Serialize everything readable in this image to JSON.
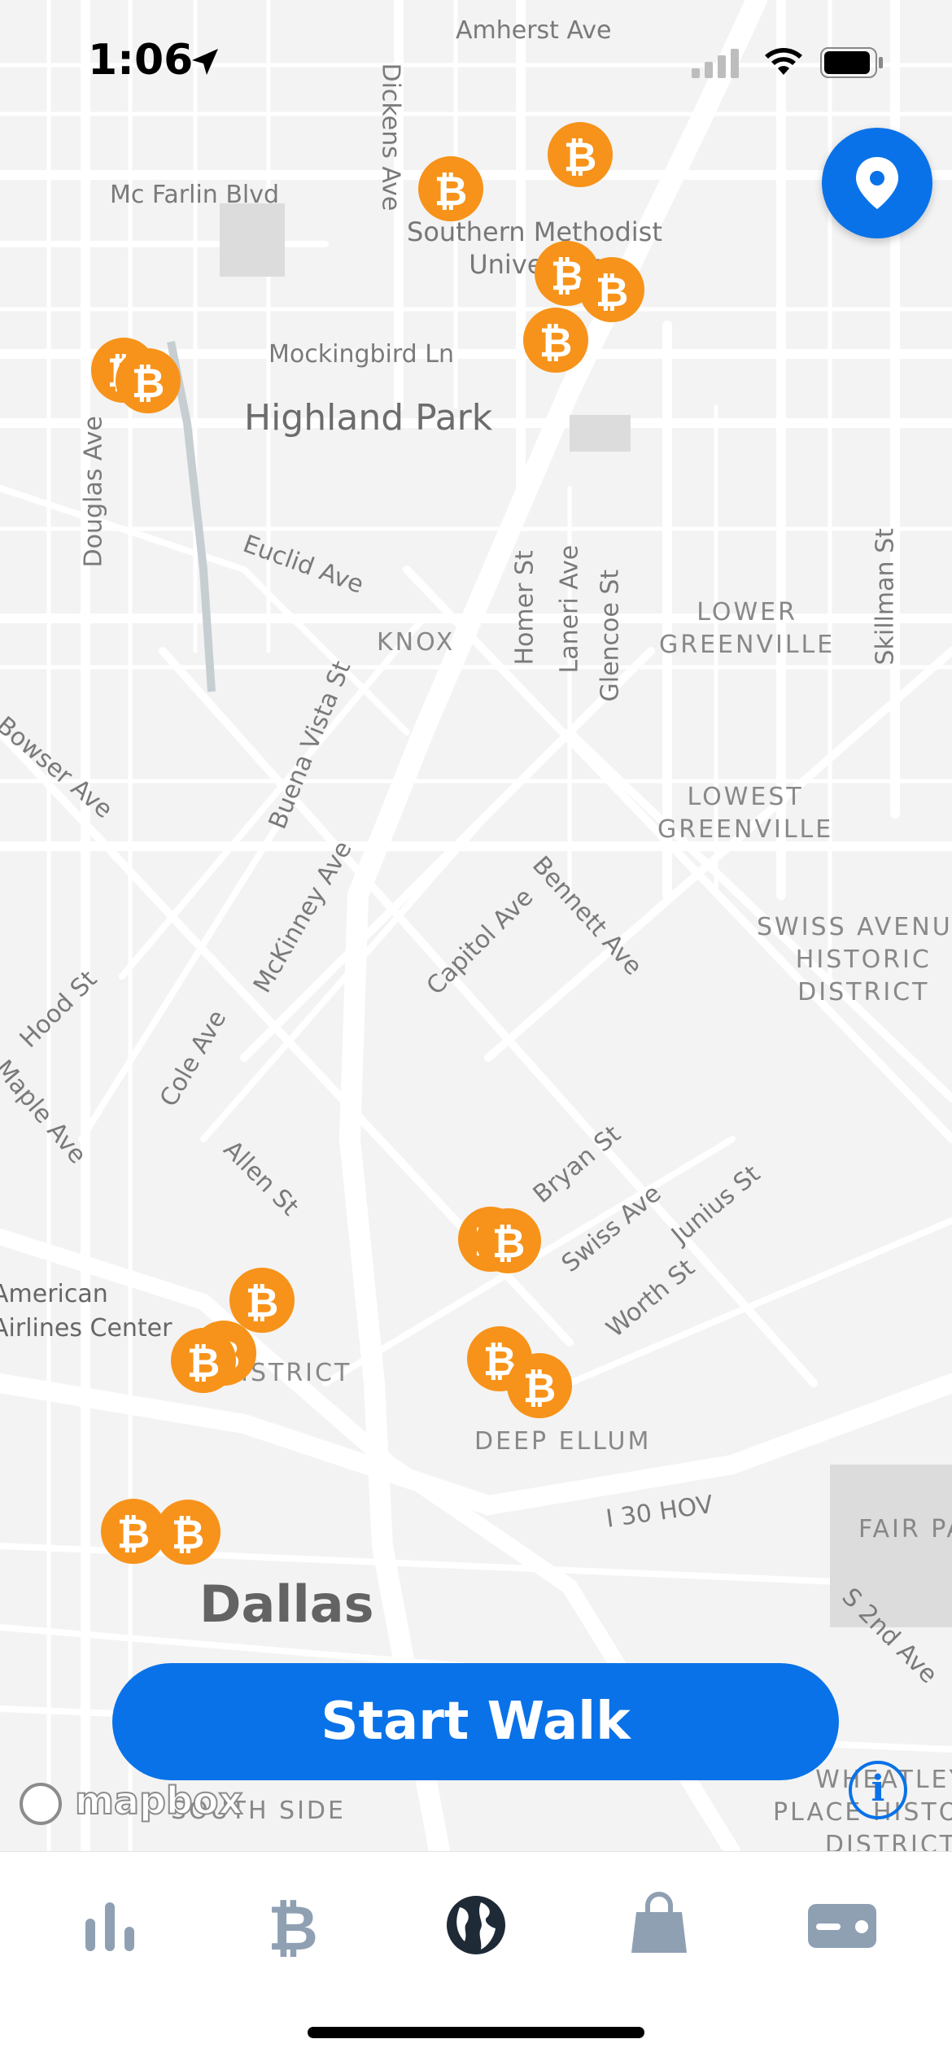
{
  "status_bar": {
    "time": "1:06"
  },
  "map": {
    "streets": [
      "Amherst Ave",
      "Mc Farlin Blvd",
      "Dickens Ave",
      "Mockingbird Ln",
      "Douglas Ave",
      "Euclid Ave",
      "Homer St",
      "Laneri Ave",
      "Glencoe St",
      "Skillman St",
      "Bowser Ave",
      "Buena Vista St",
      "McKinney Ave",
      "Capitol Ave",
      "Bennett Ave",
      "Hood St",
      "Maple Ave",
      "Cole Ave",
      "Allen St",
      "Bryan St",
      "Swiss Ave",
      "Junius St",
      "Worth St",
      "I 30 HOV",
      "S 2nd Ave"
    ],
    "places": {
      "smu": "Southern Methodist\nUniversity",
      "highland_park": "Highland Park",
      "knox": "KNOX",
      "lower_greenville": "LOWER\nGREENVILLE",
      "lowest_greenville": "LOWEST\nGREENVILLE",
      "swiss_avenue": "SWISS AVENUE\nHISTORIC\nDISTRICT",
      "american_airlines": "American\nAirlines Center",
      "arts_district": "DISTRICT",
      "deep_ellum": "DEEP ELLUM",
      "dallas": "Dallas",
      "south_side": "SOUTH SIDE",
      "fair_park": "FAIR PARK",
      "wheatley": "WHEATLEY\nPLACE HISTORIC\nDISTRICT"
    },
    "pin_symbol": "₿",
    "attribution": "mapbox"
  },
  "start_walk_label": "Start Walk",
  "tabs": [
    {
      "icon": "stats-icon"
    },
    {
      "icon": "bitcoin-icon"
    },
    {
      "icon": "globe-icon"
    },
    {
      "icon": "shopping-bag-icon"
    },
    {
      "icon": "wallet-card-icon"
    }
  ],
  "colors": {
    "accent": "#0a72e8",
    "bitcoin": "#f7931a",
    "tab_inactive": "#8fa0b3",
    "tab_active": "#1f2a37"
  }
}
